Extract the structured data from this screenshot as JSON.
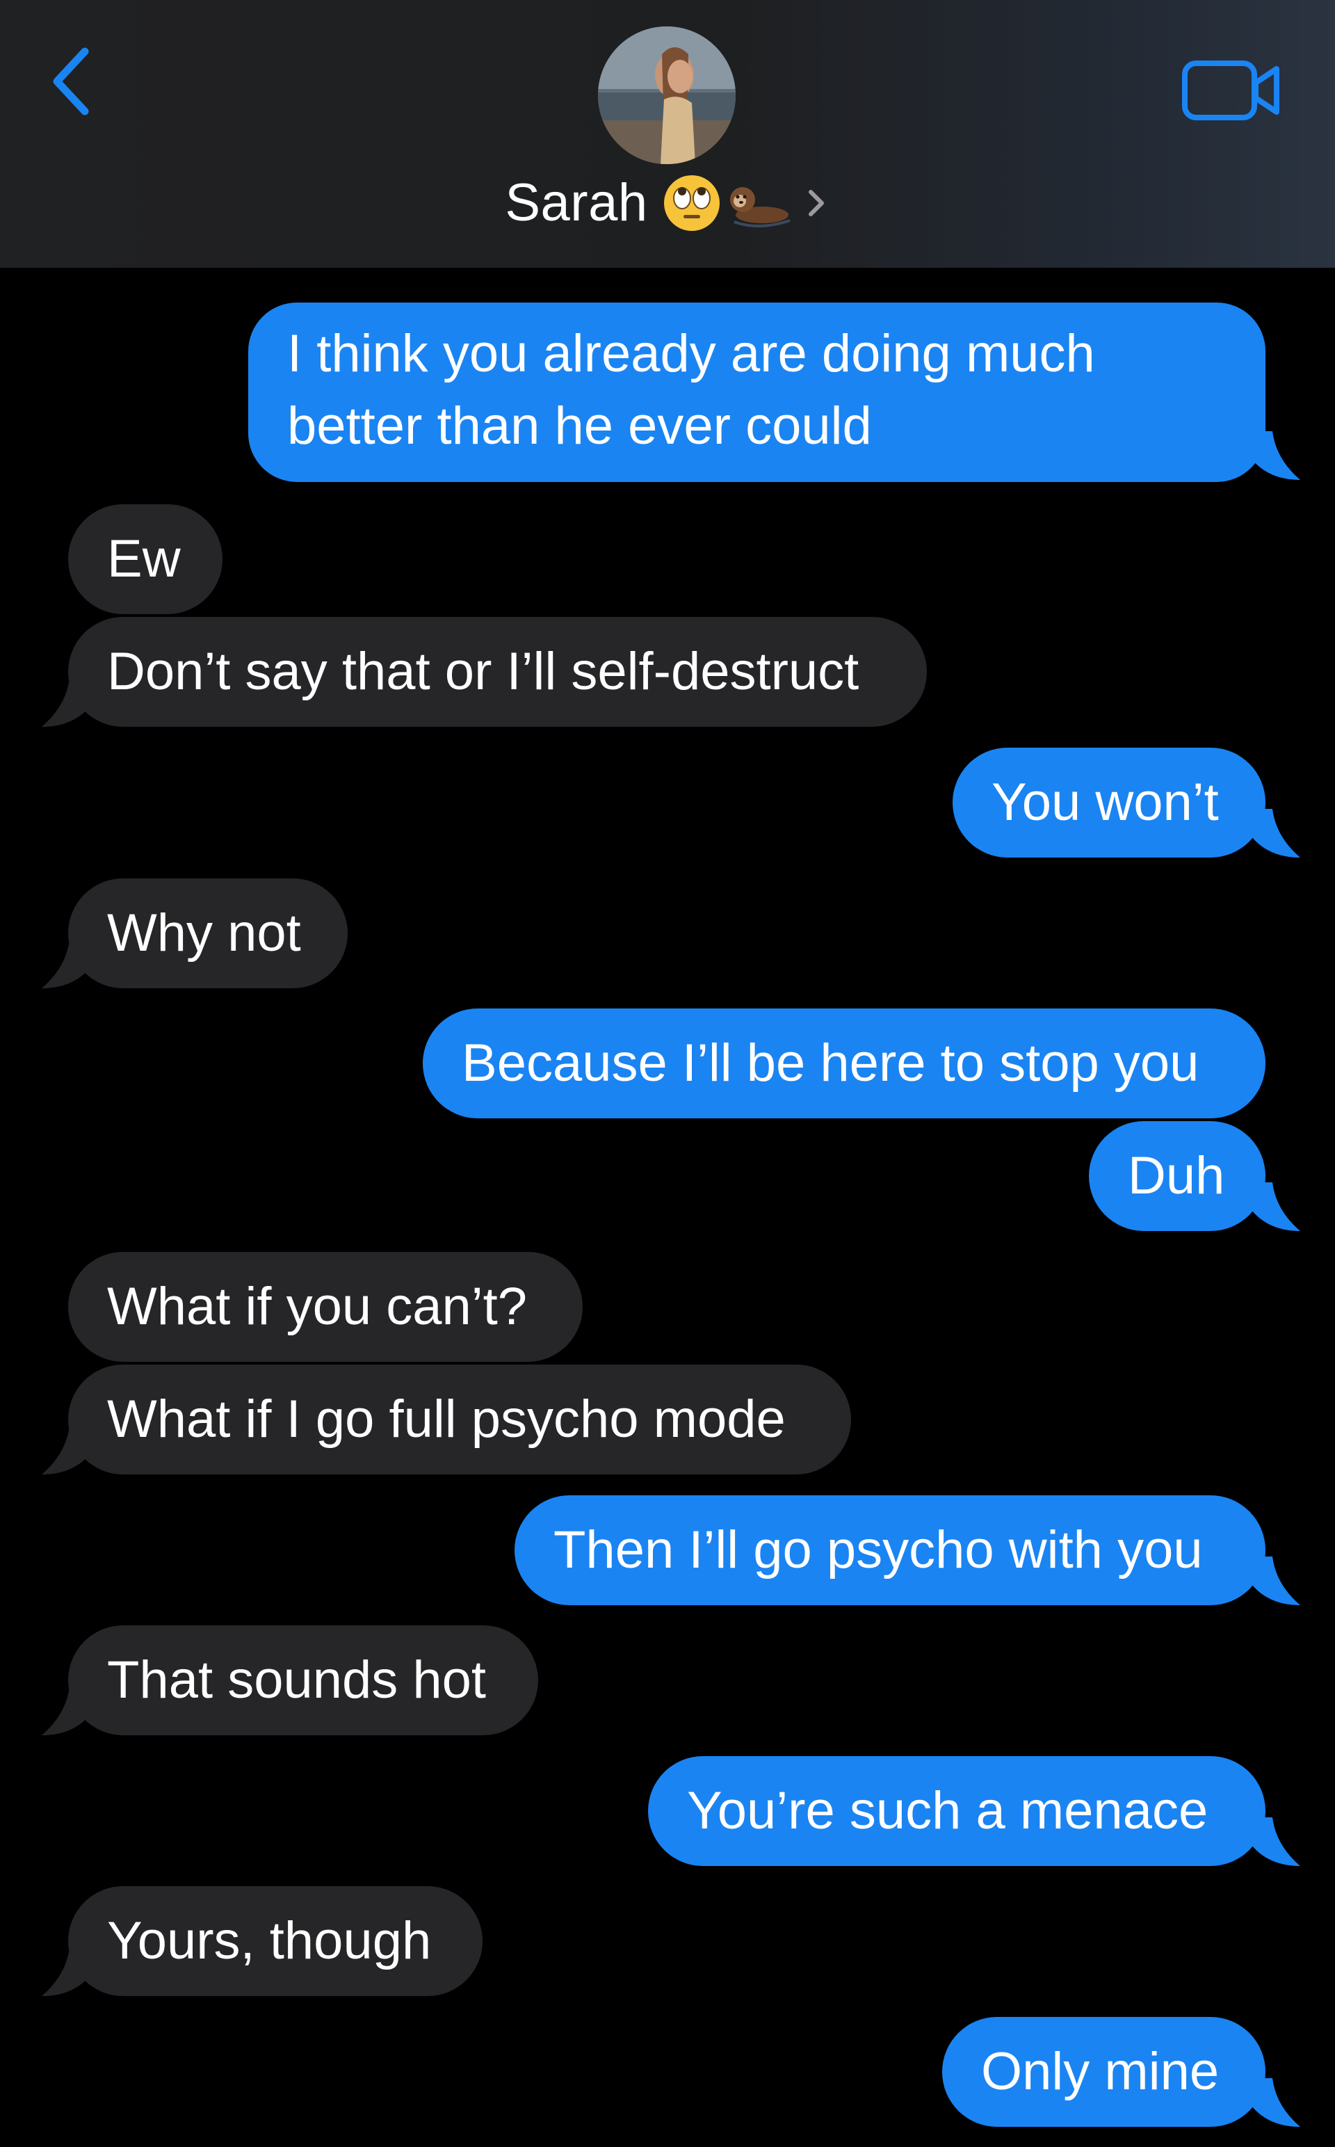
{
  "header": {
    "contact_name": "Sarah",
    "back_icon": "chevron-left-icon",
    "video_icon": "video-camera-icon",
    "name_emojis": [
      "face-with-rolling-eyes",
      "otter"
    ],
    "colors": {
      "accent": "#1a84f3",
      "header_bg": "#202122"
    }
  },
  "messages": [
    {
      "from": "me",
      "text": "I think you already are doing much better than he ever could"
    },
    {
      "from": "them",
      "text": "Ew"
    },
    {
      "from": "them",
      "text": "Don’t say that or I’ll self-destruct"
    },
    {
      "from": "me",
      "text": "You won’t"
    },
    {
      "from": "them",
      "text": "Why not"
    },
    {
      "from": "me",
      "text": "Because I’ll be here to stop you"
    },
    {
      "from": "me",
      "text": "Duh"
    },
    {
      "from": "them",
      "text": "What if you can’t?"
    },
    {
      "from": "them",
      "text": "What if I go full psycho mode"
    },
    {
      "from": "me",
      "text": "Then I’ll go psycho with you"
    },
    {
      "from": "them",
      "text": "That sounds hot"
    },
    {
      "from": "me",
      "text": "You’re such a menace"
    },
    {
      "from": "them",
      "text": "Yours, though"
    },
    {
      "from": "me",
      "text": "Only mine"
    }
  ],
  "colors": {
    "sent_bubble": "#1a84f3",
    "received_bubble": "#262628",
    "background": "#000000"
  }
}
